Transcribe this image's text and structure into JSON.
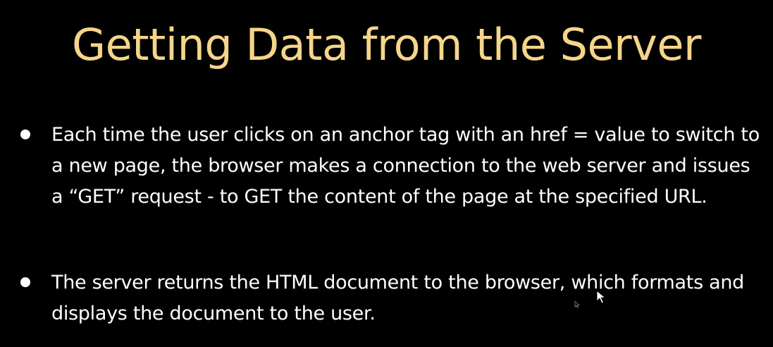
{
  "slide": {
    "title": "Getting Data from the Server",
    "bullets": [
      {
        "text": "Each time the user clicks on an anchor tag with an href =  value to switch to a new page, the browser makes a connection to the web server and issues a “GET” request - to GET the content of the page at the specified URL."
      },
      {
        "text": "The server returns the HTML document to the browser, which formats and displays the document to the user."
      }
    ],
    "icons": {
      "bullet": "bullet-dot-icon",
      "cursor": "mouse-pointer-icon"
    },
    "colors": {
      "background": "#000000",
      "title": "#f5d58a",
      "body_text": "#ffffff"
    }
  }
}
